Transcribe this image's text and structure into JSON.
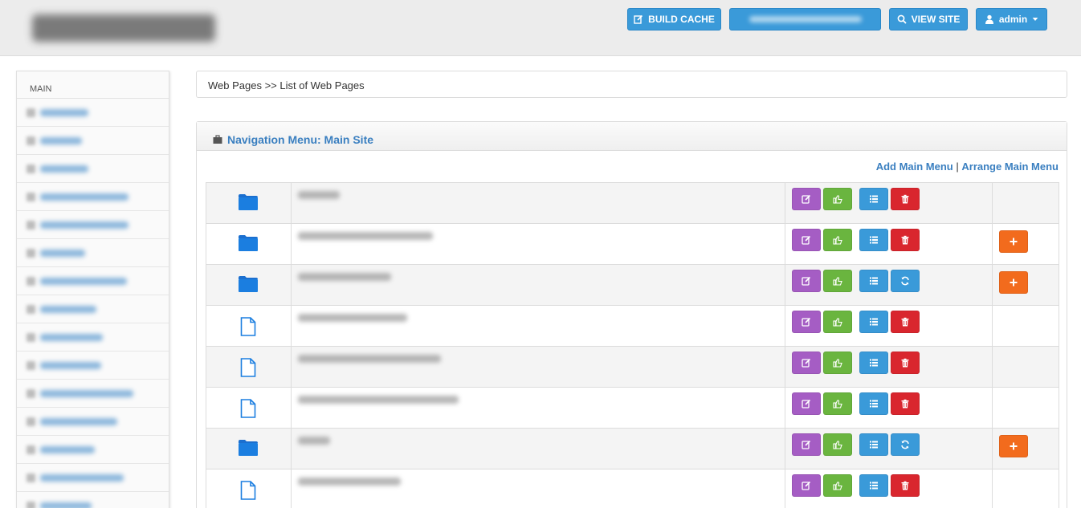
{
  "header": {
    "build_cache_label": "BUILD CACHE",
    "blurred_button_label": "",
    "view_site_label": "VIEW SITE",
    "admin_label": "admin",
    "accent_color": "#3a9ad9"
  },
  "sidebar": {
    "section_title": "MAIN",
    "items": [
      {
        "label": "",
        "icon": "dashboard-icon"
      },
      {
        "label": "",
        "icon": "edit-site-icon"
      },
      {
        "label": "",
        "icon": "menu-icon"
      },
      {
        "label": "",
        "icon": "page-icon"
      },
      {
        "label": "",
        "icon": "header-footer-icon"
      },
      {
        "label": "",
        "icon": "orders-icon"
      },
      {
        "label": "",
        "icon": "categories-icon"
      },
      {
        "label": "",
        "icon": "products-icon"
      },
      {
        "label": "",
        "icon": "mail-icon"
      },
      {
        "label": "",
        "icon": "label-icon"
      },
      {
        "label": "",
        "icon": "rates-icon"
      },
      {
        "label": "",
        "icon": "settings-icon"
      },
      {
        "label": "",
        "icon": "price-icon"
      },
      {
        "label": "",
        "icon": "shop-icon"
      },
      {
        "label": "",
        "icon": "user-icon"
      }
    ]
  },
  "breadcrumb": "Web Pages >> List of Web Pages",
  "panel": {
    "title": "Navigation Menu: Main Site",
    "add_main_menu": "Add Main Menu",
    "separator": "|",
    "arrange_main_menu": "Arrange Main Menu"
  },
  "rows": [
    {
      "icon": "folder-icon",
      "name": "",
      "fourth": "delete",
      "add": false
    },
    {
      "icon": "folder-icon",
      "name": "",
      "fourth": "delete",
      "add": true
    },
    {
      "icon": "folder-icon",
      "name": "",
      "fourth": "refresh",
      "add": true
    },
    {
      "icon": "file-icon",
      "name": "",
      "fourth": "delete",
      "add": false
    },
    {
      "icon": "file-icon",
      "name": "",
      "fourth": "delete",
      "add": false
    },
    {
      "icon": "file-icon",
      "name": "",
      "fourth": "delete",
      "add": false
    },
    {
      "icon": "folder-icon",
      "name": "",
      "fourth": "refresh",
      "add": true
    },
    {
      "icon": "file-icon",
      "name": "",
      "fourth": "delete",
      "add": false
    }
  ],
  "colors": {
    "edit": "#a55dc4",
    "approve": "#6ab53f",
    "list": "#3a9ad9",
    "delete": "#d9262e",
    "add": "#f26b1d",
    "link": "#3a7fc0"
  }
}
